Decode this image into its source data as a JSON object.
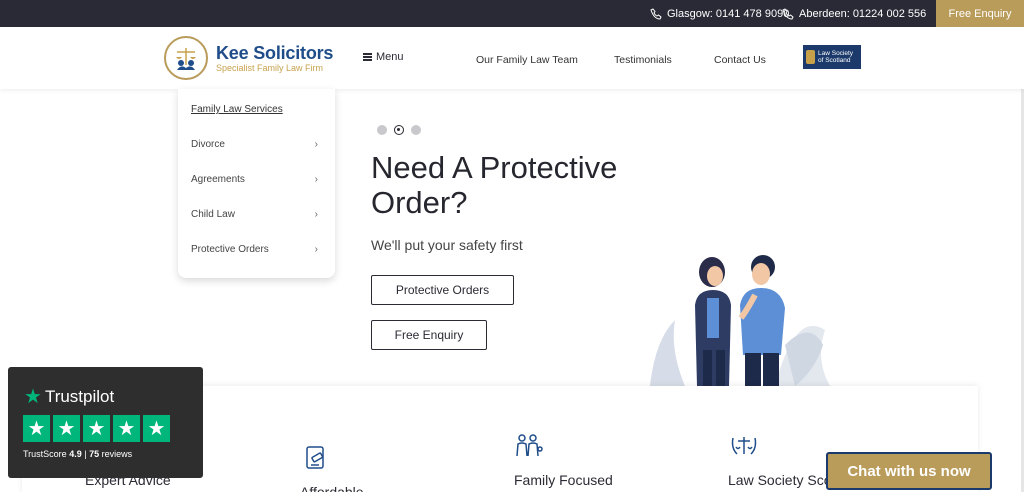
{
  "topbar": {
    "glasgow": "Glasgow: 0141 478 9090",
    "aberdeen": "Aberdeen: 01224 002 556",
    "enquiry": "Free Enquiry"
  },
  "header": {
    "logo_name": "Kee Solicitors",
    "logo_tag": "Specialist Family Law Firm",
    "menu": "Menu",
    "nav": [
      "Our Family Law Team",
      "Testimonials",
      "Contact Us"
    ],
    "badge_line1": "Law Society",
    "badge_line2": "of Scotland"
  },
  "dropdown": {
    "title": "Family Law Services",
    "items": [
      "Divorce",
      "Agreements",
      "Child Law",
      "Protective Orders"
    ]
  },
  "hero": {
    "title_line1": "Need A Protective",
    "title_line2": "Order?",
    "subtitle": "We'll put your safety first",
    "btn_primary": "Protective Orders",
    "btn_secondary": "Free Enquiry",
    "slides_active": 2
  },
  "features": [
    "Expert Advice",
    "Affordable",
    "Family Focused",
    "Law Society Sco"
  ],
  "trustpilot": {
    "brand": "Trustpilot",
    "score_label": "TrustScore",
    "score": "4.9",
    "separator": "|",
    "reviews": "75",
    "reviews_label": "reviews"
  },
  "chat": "Chat with us now",
  "colors": {
    "accent": "#b99b5a",
    "navy": "#1b3a6b",
    "dark": "#2a2a36",
    "trust_green": "#00b67a"
  }
}
